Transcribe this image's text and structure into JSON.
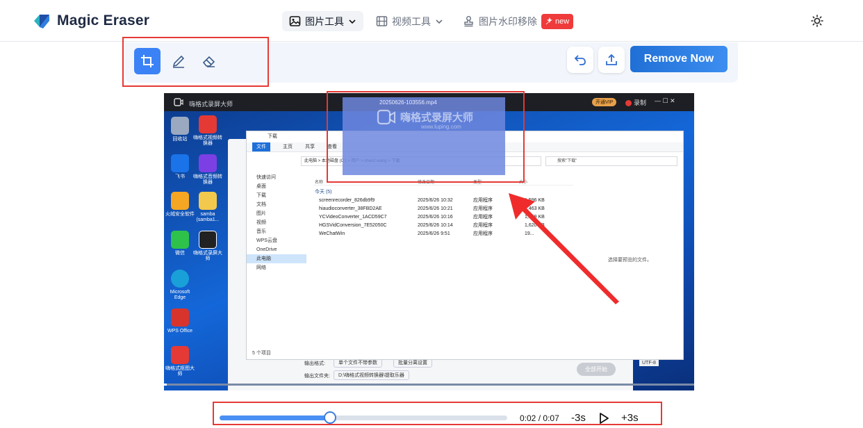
{
  "app": {
    "brand_name": "Magic Eraser",
    "brand_colors": {
      "primary": "#1f6fd6",
      "accent_teal": "#2bb3c0",
      "danger": "#e53935"
    }
  },
  "nav": {
    "items": [
      {
        "label": "图片工具",
        "icon": "image-icon",
        "has_dropdown": true,
        "active": true
      },
      {
        "label": "视频工具",
        "icon": "film-icon",
        "has_dropdown": true,
        "active": false
      },
      {
        "label": "图片水印移除",
        "icon": "stamp-icon",
        "has_dropdown": false,
        "active": false
      }
    ],
    "new_badge": "new",
    "theme_toggle_icon": "sun-icon"
  },
  "toolbar": {
    "tools": [
      {
        "icon": "crop-icon",
        "active": true
      },
      {
        "icon": "pen-icon",
        "active": false
      },
      {
        "icon": "eraser-icon",
        "active": false
      }
    ],
    "undo_icon": "undo-icon",
    "export_icon": "upload-icon",
    "remove_label": "Remove Now"
  },
  "video_frame": {
    "recorder_title": "嗨格式录屏大师",
    "recorder_vip": "开通VIP",
    "recorder_rec": "录制",
    "watermark_filename": "20250626-103556.mp4",
    "watermark_brand": "嗨格式录屏大师",
    "watermark_url": "www.luping.com",
    "desktop_icons": [
      {
        "label": "回收站",
        "color": "#9aa9bf"
      },
      {
        "label": "嗨格式视频转换器",
        "color": "#e53935"
      },
      {
        "label": "飞书",
        "color": "#1a73e8"
      },
      {
        "label": "嗨格式音频转换器",
        "color": "#7b3fe4"
      },
      {
        "label": "火绒安全软件",
        "color": "#f5a623"
      },
      {
        "label": "samba (samba1...",
        "color": "#f2c94c"
      },
      {
        "label": "微信",
        "color": "#2ec24a"
      },
      {
        "label": "嗨格式录屏大师",
        "color": "#222222"
      },
      {
        "label": "Microsoft Edge",
        "color": "#1aa0d8"
      },
      {
        "label": "WPS Office",
        "color": "#d9342b"
      },
      {
        "label": "嗨格式抠图大师",
        "color": "#e53935"
      }
    ],
    "explorer": {
      "title": "下载",
      "ribbon": [
        "文件",
        "主页",
        "共享",
        "查看"
      ],
      "address": "此电脑 > 本地磁盘 (C:) > 用户 > chen2.wang > 下载",
      "search_placeholder": "搜索\"下载\"",
      "sidebar": [
        "快速访问",
        "桌面",
        "下载",
        "文档",
        "图片",
        "视频",
        "音乐",
        "WPS云盘",
        "OneDrive",
        "此电脑",
        "网络"
      ],
      "columns": [
        "名称",
        "修改日期",
        "类型",
        "大小"
      ],
      "group_label": "今天 (5)",
      "rows": [
        {
          "name": "screenrecorder_826db9f9",
          "date": "2025/6/26 10:32",
          "type": "应用程序",
          "size": "1,596 KB"
        },
        {
          "name": "hiaudioconverter_38FBD2AE",
          "date": "2025/6/26 10:21",
          "type": "应用程序",
          "size": "2,463 KB"
        },
        {
          "name": "YCVideoConverter_1ACD59C7",
          "date": "2025/6/26 10:16",
          "type": "应用程序",
          "size": "1,599 KB"
        },
        {
          "name": "HGSVidConversion_7E52050C",
          "date": "2025/6/26 10:14",
          "type": "应用程序",
          "size": "1,620 KB"
        },
        {
          "name": "WeChatWin",
          "date": "2025/6/26 9:51",
          "type": "应用程序",
          "size": "19..."
        }
      ],
      "preview_text": "选择要预览的文件。",
      "status": "5 个项目"
    },
    "app_behind": {
      "output_format_label": "输出格式:",
      "output_format_value": "单个文件不带参数",
      "batch_label": "批量分离设置",
      "output_folder_label": "输出文件夹:",
      "output_folder_value": "D:\\嗨格式视频转换器\\提取乐器",
      "start_label": "全部开始",
      "os_label": "UTF-8"
    }
  },
  "player": {
    "progress": 0.385,
    "current_time": "0:02",
    "separator": "/",
    "duration": "0:07",
    "back_label": "-3s",
    "forward_label": "+3s"
  }
}
